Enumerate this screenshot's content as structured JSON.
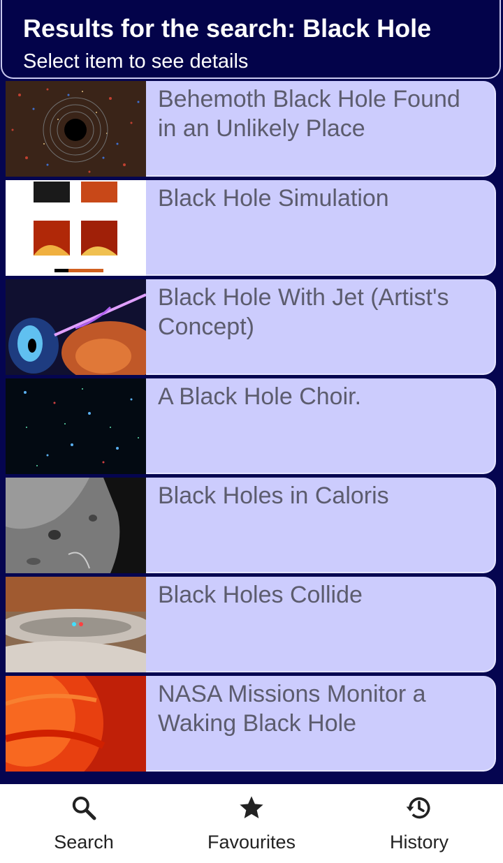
{
  "header": {
    "title": "Results for the search: Black Hole",
    "subtitle": "Select item to see details"
  },
  "results": [
    {
      "title": "Behemoth Black Hole Found in an Unlikely Place",
      "thumbnail": "galaxy-black-hole-image"
    },
    {
      "title": "Black Hole Simulation",
      "thumbnail": "simulation-plots-image"
    },
    {
      "title": "Black Hole With Jet (Artist's Concept)",
      "thumbnail": "black-hole-jet-image"
    },
    {
      "title": "A Black Hole Choir.",
      "thumbnail": "starfield-image"
    },
    {
      "title": "Black Holes in Caloris",
      "thumbnail": "crater-surface-image"
    },
    {
      "title": "Black Holes Collide",
      "thumbnail": "colliding-holes-image"
    },
    {
      "title": "NASA Missions Monitor a Waking Black Hole",
      "thumbnail": "sun-surface-image"
    }
  ],
  "nav": {
    "search": {
      "label": "Search",
      "icon": "search-icon"
    },
    "favourites": {
      "label": "Favourites",
      "icon": "star-icon"
    },
    "history": {
      "label": "History",
      "icon": "history-icon"
    }
  },
  "colors": {
    "background": "#050550",
    "header": "#03034a",
    "card": "#ccccfd",
    "card_text": "#5c5c6e",
    "nav_background": "#ffffff"
  }
}
